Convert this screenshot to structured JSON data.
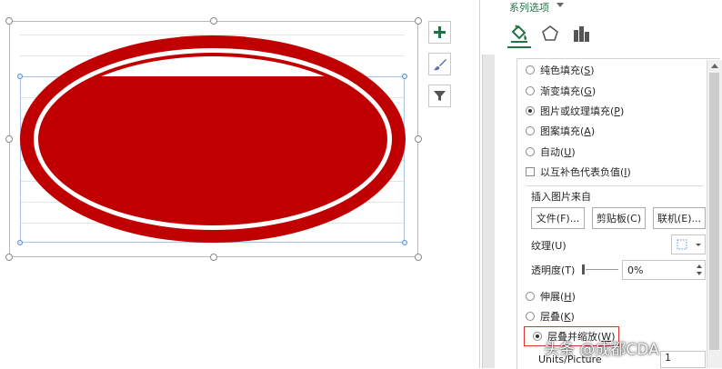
{
  "chart": {
    "ellipse_color": "#c00000",
    "gridline_color": "#e4e4e4"
  },
  "chart_tools": {
    "add_element_icon": "plus-icon",
    "styles_icon": "brush-icon",
    "filter_icon": "funnel-icon"
  },
  "pane": {
    "series_options_title": "系列选项",
    "category_icons": [
      "paint-bucket-icon",
      "pentagon-icon",
      "bar-chart-icon"
    ],
    "fill_options": [
      {
        "label": "纯色填充(",
        "hotkey": "S",
        "suffix": ")",
        "selected": false
      },
      {
        "label": "渐变填充(",
        "hotkey": "G",
        "suffix": ")",
        "selected": false
      },
      {
        "label": "图片或纹理填充(",
        "hotkey": "P",
        "suffix": ")",
        "selected": true
      },
      {
        "label": "图案填充(",
        "hotkey": "A",
        "suffix": ")",
        "selected": false
      },
      {
        "label": "自动(",
        "hotkey": "U",
        "suffix": ")",
        "selected": false
      }
    ],
    "invert_checkbox": {
      "label": "以互补色代表负值(",
      "hotkey": "I",
      "suffix": ")",
      "checked": false
    },
    "insert_from_label": "插入图片来自",
    "buttons": {
      "file": "文件(F)...",
      "clipboard": "剪贴板(C)",
      "online": "联机(E)..."
    },
    "texture_label": "纹理(U)",
    "transparency_label": "透明度(T)",
    "transparency_value": "0%",
    "stack_options": [
      {
        "label": "伸展(",
        "hotkey": "H",
        "suffix": ")",
        "selected": false
      },
      {
        "label": "层叠(",
        "hotkey": "K",
        "suffix": ")",
        "selected": false
      },
      {
        "label": "层叠并缩放(",
        "hotkey": "W",
        "suffix": ")",
        "selected": true
      }
    ],
    "units_label": "Units/Picture",
    "units_value": "1",
    "accent_color": "#217346",
    "highlight_color": "#e03030"
  },
  "watermark": "头条 @成都CDA"
}
